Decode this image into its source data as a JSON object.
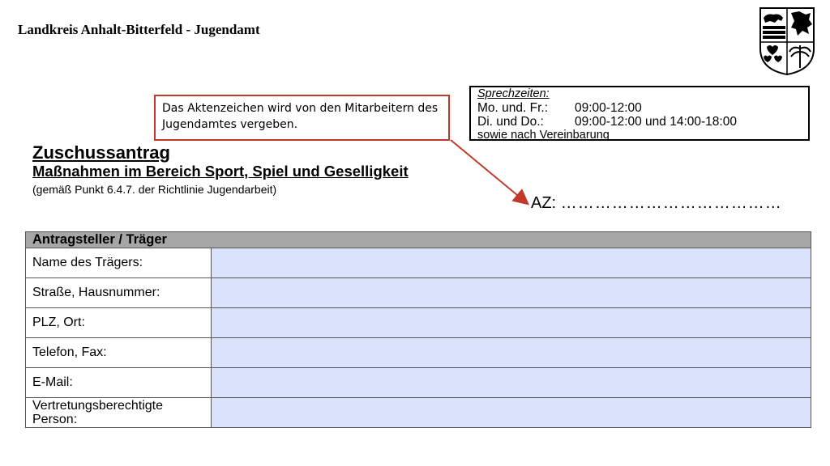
{
  "header": {
    "title": "Landkreis Anhalt-Bitterfeld - Jugendamt"
  },
  "crest": {
    "icon": "coat-of-arms-icon"
  },
  "hours": {
    "title": "Sprechzeiten:",
    "rows": [
      {
        "days": "Mo. und. Fr.:",
        "times": "09:00-12:00"
      },
      {
        "days": "Di. und Do.:",
        "times": "09:00-12:00 und 14:00-18:00"
      }
    ],
    "note": "sowie nach Vereinbarung"
  },
  "callout": {
    "text": "Das Aktenzeichen wird von den Mitarbeitern des Jugendamtes vergeben.",
    "color": "#c0392b"
  },
  "form": {
    "title": "Zuschussantrag",
    "subtitle": "Maßnahmen im Bereich Sport, Spiel und Geselligkeit",
    "note": "(gemäß Punkt 6.4.7. der Richtlinie Jugendarbeit)",
    "az_label": "AZ:",
    "az_dots": "…………………………………",
    "section_header": "Antragsteller / Träger",
    "fields": [
      {
        "label": "Name des Trägers:"
      },
      {
        "label": "Straße, Hausnummer:"
      },
      {
        "label": "PLZ, Ort:"
      },
      {
        "label": "Telefon, Fax:"
      },
      {
        "label": "E-Mail:"
      },
      {
        "label": "Vertretungsberechtigte Person:"
      }
    ],
    "input_color": "#dbe2fb",
    "header_color": "#a6a6a6"
  }
}
